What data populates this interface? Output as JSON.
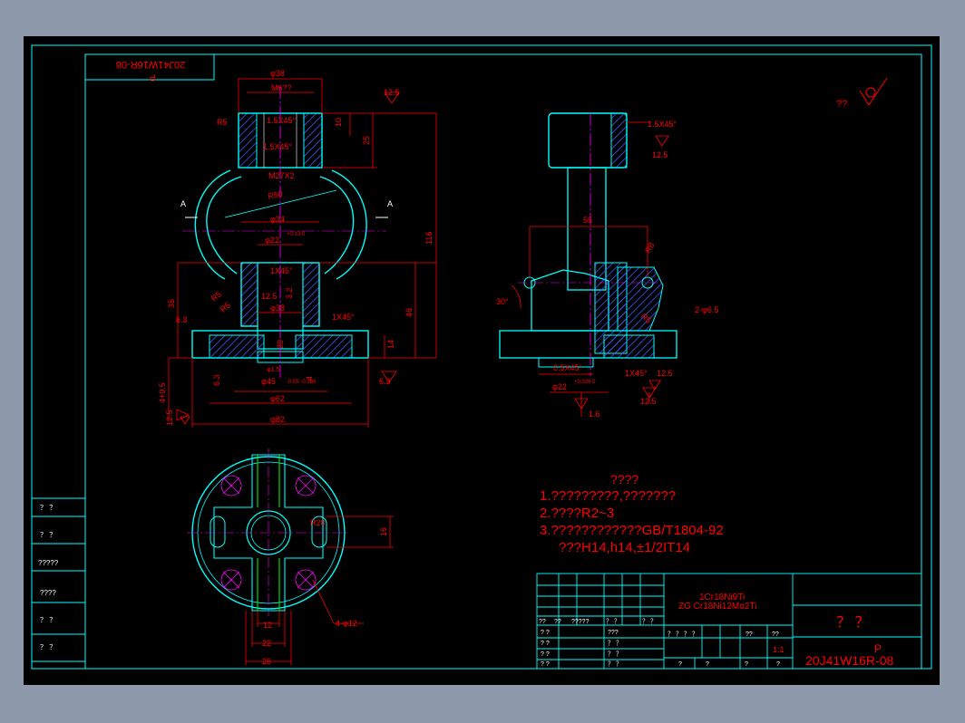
{
  "title_block": {
    "code_mirrored": "20J41W16R-08",
    "p_mirrored": "P",
    "material_1": "1Cr18Ni9Ti",
    "material_2": "ZG  Cr18Ni12Mo2Ti",
    "name": "？ ？",
    "drawing_no": "20J41W16R-08",
    "p_label": "P",
    "scale": "1:1",
    "cells": {
      "r1a": "??",
      "r1b": "??",
      "r1c": "?????",
      "r1d": "？ ？",
      "r1e": "？ ？",
      "r2a": "? ?",
      "r2b": "???",
      "r2c": "？ ？ ？ ？",
      "r2d": "??",
      "r2e": "??",
      "r3a": "? ?",
      "r3b": "？ ？",
      "r4a": "? ?",
      "r4b": "？ ？",
      "r5a": "? ?",
      "r5b": "？ ？",
      "r5c": "?",
      "r5d": "?",
      "r5e": "?",
      "r5f": "?"
    }
  },
  "left_strip": [
    "？ ？",
    "？ ？",
    "?????",
    "????",
    "？ ？",
    "？ ？"
  ],
  "roughness_note": "??",
  "notes": {
    "heading": "????",
    "line1": "1.?????????,???????",
    "line2": "2.????R2~3",
    "line3": "3.????????????GB/T1804-92",
    "line4": "???H14,h14,±1/2IT14"
  },
  "dims": {
    "d38_top": "φ38",
    "m6": "M6??",
    "r5_top": "R5",
    "c15_a": "1.5X45°",
    "c15_b": "1.5X45°",
    "m27": "M27X2",
    "r50": "R50",
    "d34": "φ34",
    "d22": "φ22",
    "d22_tol": "+0.13 0",
    "c1": "1X45°",
    "d38_mid": "φ38",
    "r5_left": "R5",
    "r5_l2": "R5",
    "c1_r": "1X45°",
    "d45": "φ45",
    "d45_tol": "-0.05 -0.160",
    "d62": "φ62",
    "d82": "φ82",
    "d15": "φ1.5",
    "dim10": "10",
    "dim25": "25",
    "dim116": "116",
    "dim46": "46",
    "dim35": "35",
    "dim14": "14",
    "dim20": "20",
    "dim4": "4",
    "dim4_05": "4+0.5",
    "dim63": "6.3",
    "r125a": "12.5",
    "r125b": "12.5",
    "r125c": "12.5",
    "r63a": "6.3",
    "r63b": "6.3",
    "r32": "3.2",
    "rA": "A",
    "rA2": "A",
    "side_c15": "1.5X45°",
    "side_r125": "12.5",
    "side_55": "55",
    "side_r8": "R8",
    "side_30": "30°",
    "side_2d65": "2-φ6.5",
    "side_r5": "R5",
    "side_c05": "0.5X45°",
    "side_c1": "1X45°",
    "side_r125b": "12.5",
    "side_d22": "φ22",
    "side_d22_tol": "+0.026 0",
    "side_r16": "1.6",
    "side_r125c": "12.5",
    "plan_r20": "R20",
    "plan_16": "16",
    "plan_4d12": "4-φ12",
    "plan_12": "12",
    "plan_22": "22",
    "plan_26": "26"
  },
  "colors": {
    "background": "#000000",
    "frame": "#00ffff",
    "outer_bg": "#8e9aac",
    "dimension": "#ff0000",
    "geometry": "#00ffff",
    "green": "#00ff00",
    "magenta": "#ff00ff",
    "white": "#ffffff",
    "yellow": "#ffff00"
  }
}
